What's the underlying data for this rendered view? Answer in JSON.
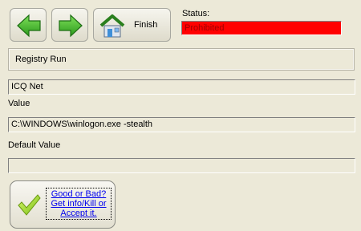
{
  "toolbar": {
    "back_icon": "arrow-left-icon",
    "forward_icon": "arrow-right-icon",
    "finish_icon": "house-icon",
    "finish_label": "Finish"
  },
  "status": {
    "label": "Status:",
    "value": "Prohibited",
    "color": "#ff0000"
  },
  "section": {
    "title": "Registry Run"
  },
  "entry": {
    "name": "ICQ Net",
    "value_label": "Value",
    "value": "C:\\WINDOWS\\winlogon.exe -stealth",
    "default_label": "Default Value",
    "default_value": ""
  },
  "verdict": {
    "icon": "checkmark-icon",
    "link_text": "Good or Bad? Get info/Kill or Accept it."
  }
}
